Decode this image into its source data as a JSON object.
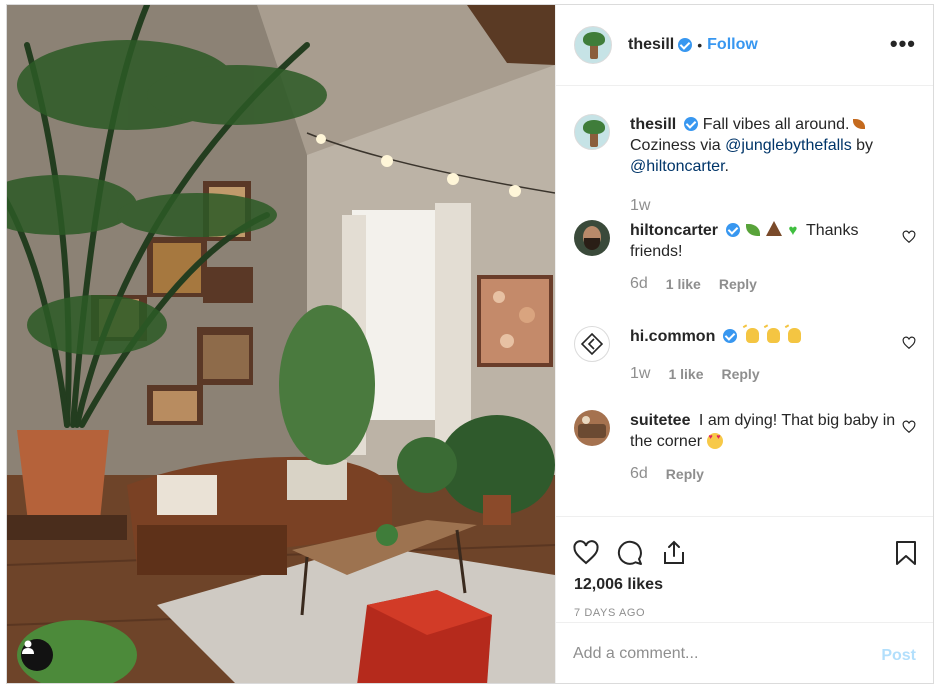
{
  "post": {
    "author": "thesill",
    "follow_label": "Follow",
    "more_label": "•••",
    "separator": "•"
  },
  "comments": [
    {
      "user": "thesill",
      "text_before": "Fall vibes all around.",
      "text_middle": "Coziness via",
      "mention1": "@junglebythefalls",
      "text_by": "by",
      "mention2": "@hiltoncarter",
      "text_end": ".",
      "time": "1w"
    },
    {
      "user": "hiltoncarter",
      "text": "Thanks friends!",
      "time": "6d",
      "likes": "1 like",
      "reply": "Reply"
    },
    {
      "user": "hi.common",
      "time": "1w",
      "likes": "1 like",
      "reply": "Reply"
    },
    {
      "user": "suitetee",
      "text": "I am dying! That big baby in the corner",
      "time": "6d",
      "reply": "Reply"
    }
  ],
  "stats": {
    "likes": "12,006 likes",
    "posted": "7 DAYS AGO"
  },
  "add_comment": {
    "placeholder": "Add a comment...",
    "post_label": "Post"
  },
  "icons": [
    "heart-icon",
    "comment-icon",
    "share-icon",
    "bookmark-icon",
    "more-icon",
    "user-tag-icon",
    "verified-icon"
  ],
  "colors": {
    "link_blue": "#3897f0",
    "mention_navy": "#003569",
    "muted_grey": "#8e8e8e",
    "post_disabled": "#b2dffc"
  }
}
